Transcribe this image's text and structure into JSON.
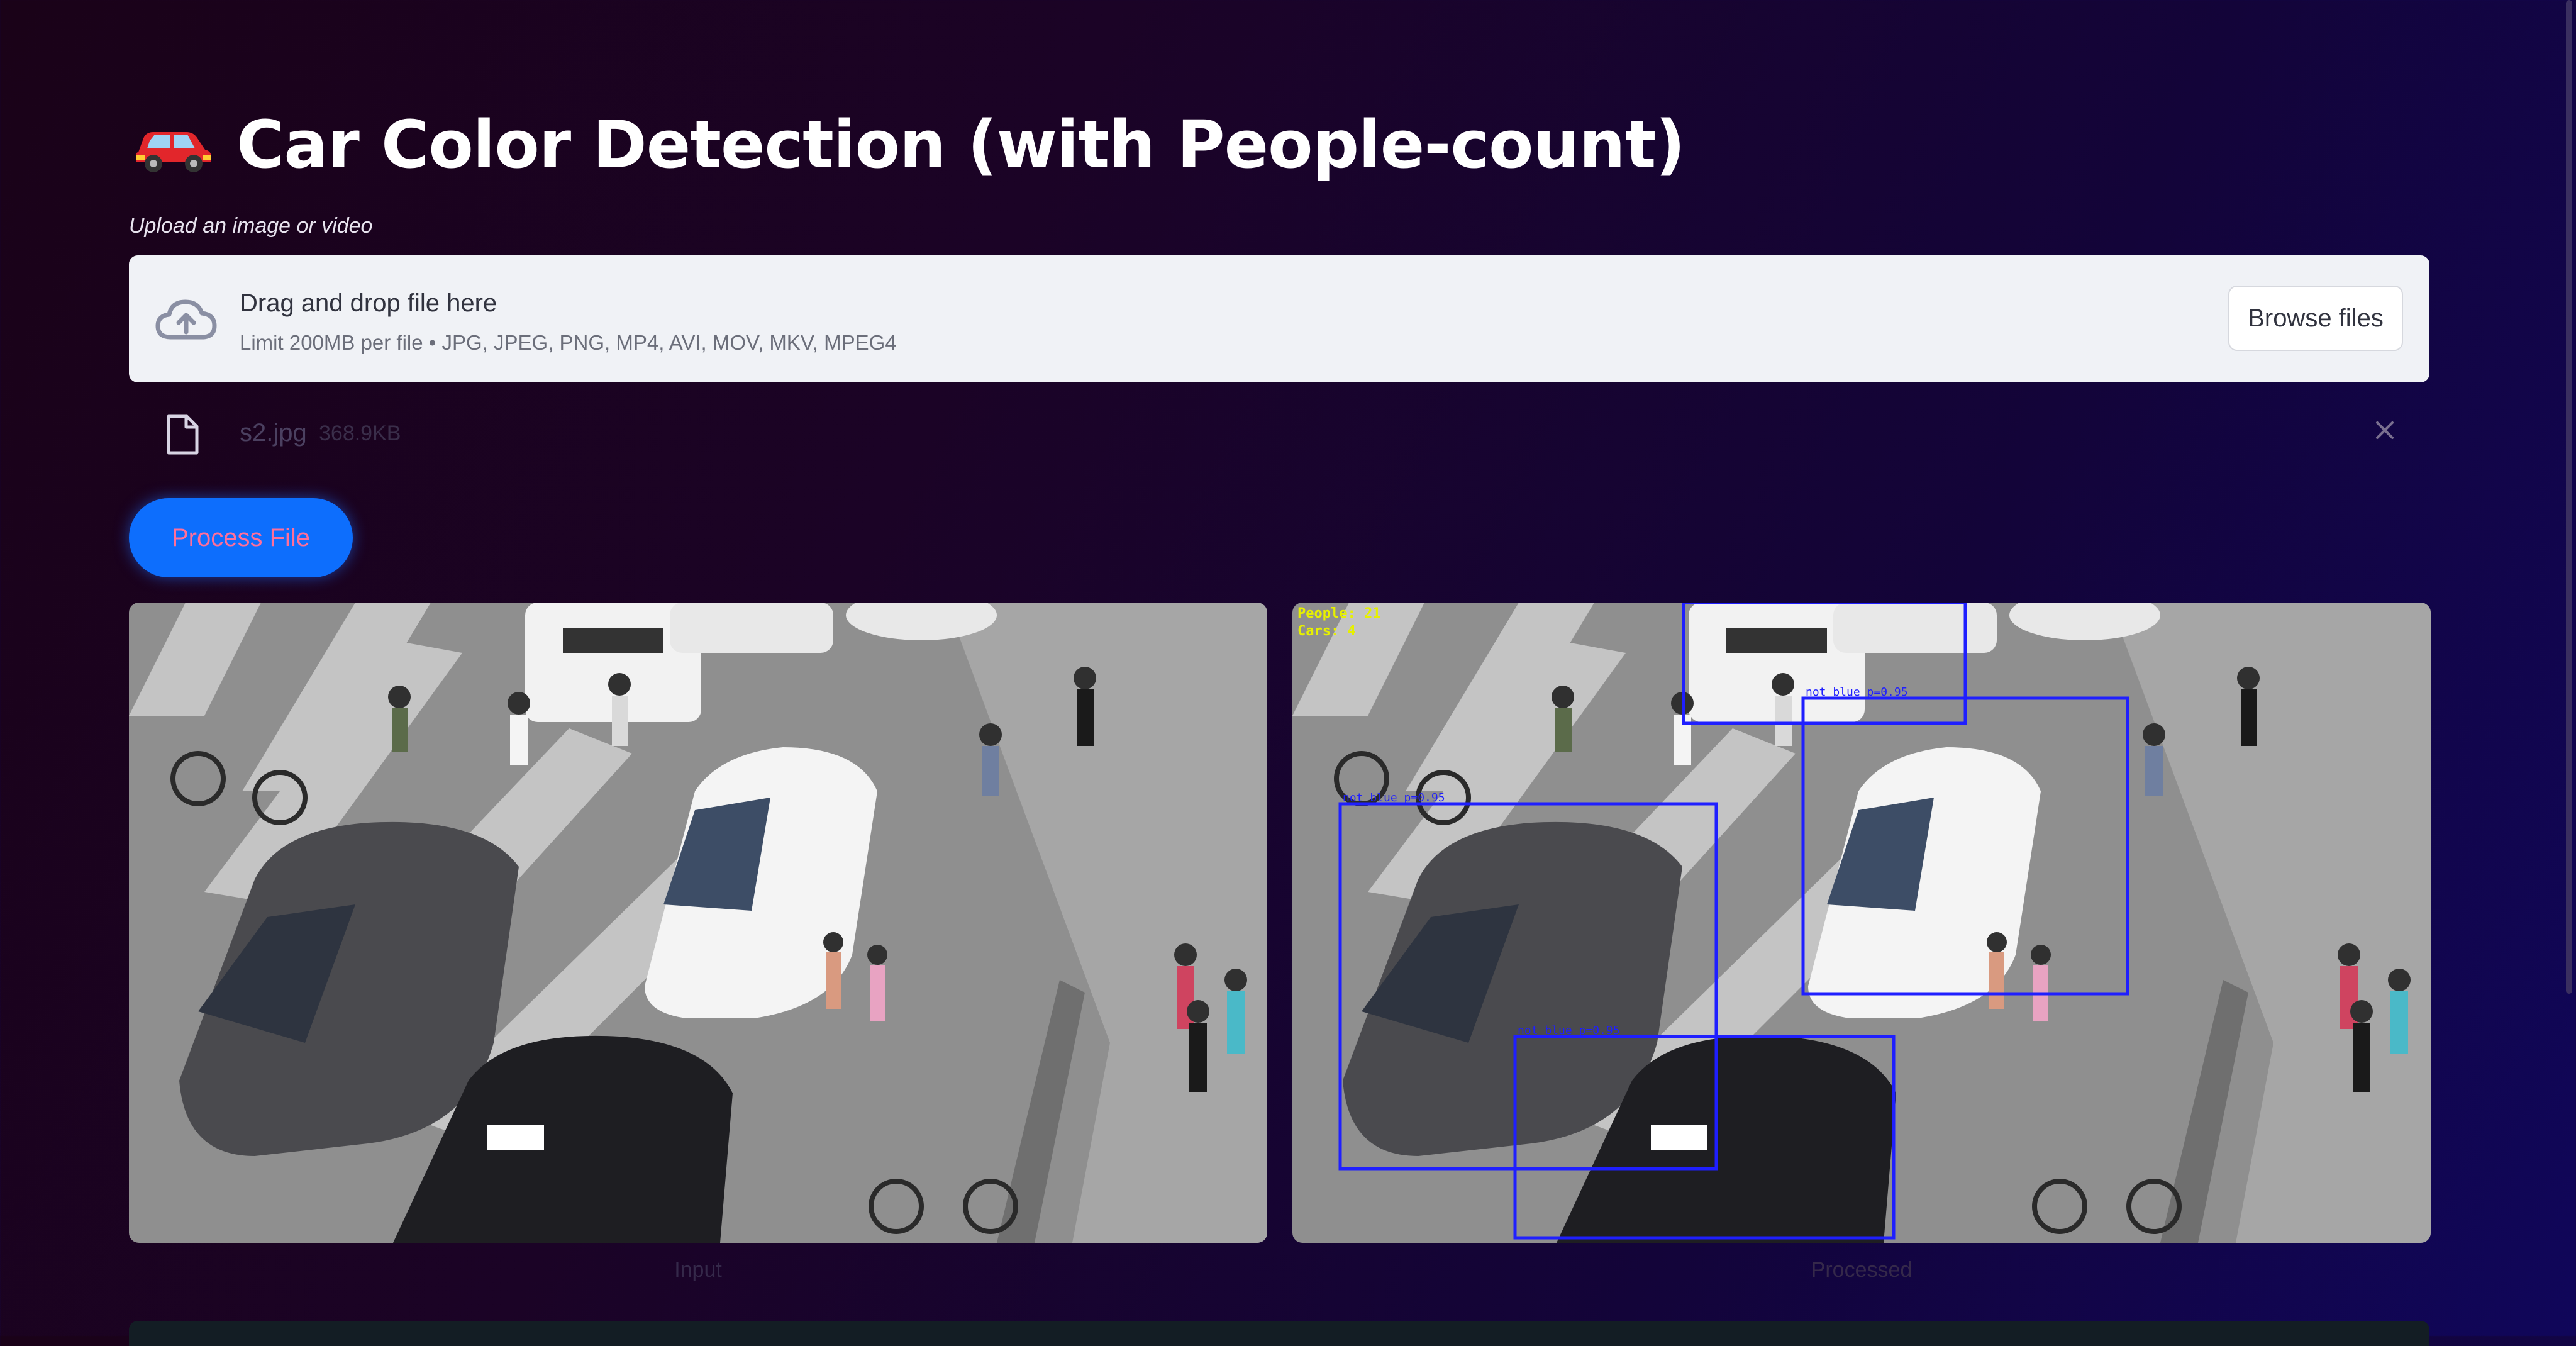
{
  "header": {
    "title": "Car Color Detection (with People-count)",
    "emoji_icon": "car-icon"
  },
  "uploader": {
    "label": "Upload an image or video",
    "drop_title": "Drag and drop file here",
    "limit_text": "Limit 200MB per file • JPG, JPEG, PNG, MP4, AVI, MOV, MKV, MPEG4",
    "browse_label": "Browse files"
  },
  "uploaded_file": {
    "name": "s2.jpg",
    "size": "368.9KB"
  },
  "process_button": {
    "label": "Process File"
  },
  "images": {
    "input_caption": "Input",
    "processed_caption": "Processed",
    "overlay_people": "People: 21",
    "overlay_cars": "Cars: 4",
    "box_label": "not_blue p=0.95",
    "box_color": "#1f1fff",
    "overlay_text_color": "#e6f000"
  },
  "colors": {
    "accent": "#0d6efd",
    "accent_text": "#ff6f9a"
  }
}
